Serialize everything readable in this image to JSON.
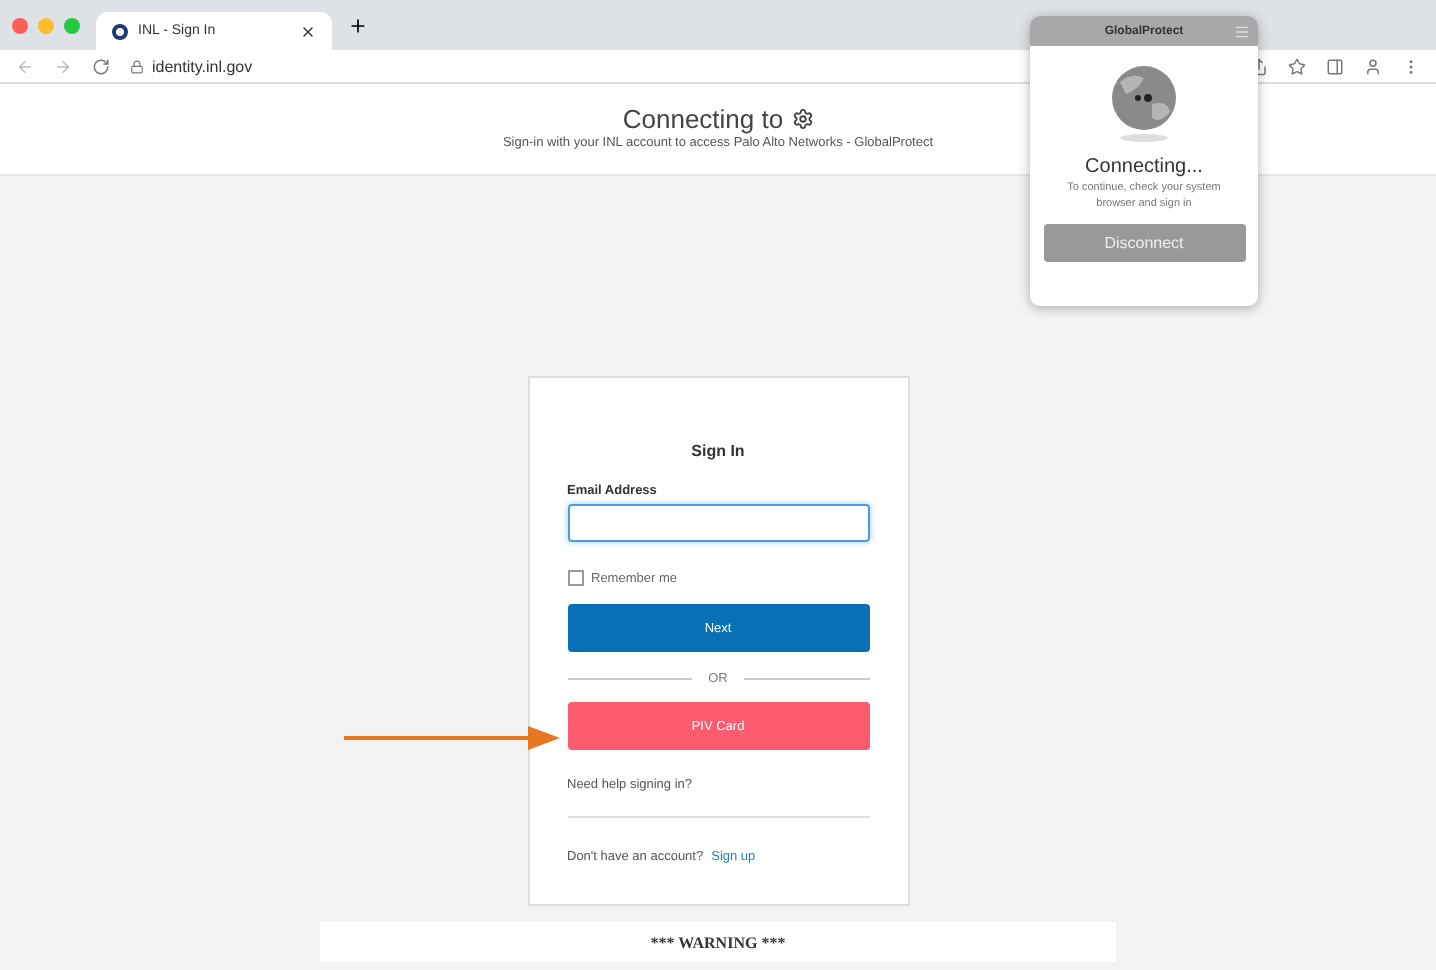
{
  "browser": {
    "tabs": [
      {
        "title": "INL - Sign In",
        "selected": true
      }
    ],
    "address": "identity.inl.gov"
  },
  "header": {
    "title": "Connecting to",
    "subtitle": "Sign-in with your INL account to access Palo Alto Networks - GlobalProtect"
  },
  "sign_in": {
    "heading": "Sign In",
    "email_label": "Email Address",
    "remember": {
      "label": "Remember me",
      "checked": false
    },
    "next_button": "Next",
    "divider": "OR",
    "piv_button": "PIV Card",
    "help_link": "Need help signing in?",
    "signup_prompt": "Don't have an account?",
    "signup_link": "Sign up"
  },
  "warning": "*** WARNING ***",
  "popup": {
    "title": "GlobalProtect",
    "status": "Connecting...",
    "message": "To continue, check your system browser and sign in",
    "button": "Disconnect"
  }
}
